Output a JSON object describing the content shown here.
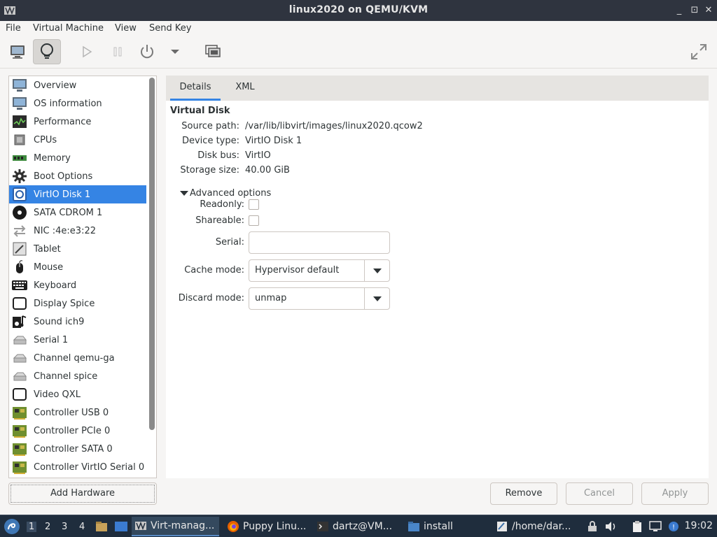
{
  "window": {
    "title": "linux2020 on QEMU/KVM",
    "controls": {
      "minimize": "_",
      "maximize": "⊡",
      "close": "✕"
    }
  },
  "menubar": {
    "items": [
      "File",
      "Virtual Machine",
      "View",
      "Send Key"
    ]
  },
  "toolbar": {
    "icons": [
      "console-icon",
      "details-lightbulb-icon",
      "run-play-icon",
      "pause-icon",
      "power-icon",
      "dropdown-arrow-icon",
      "snapshots-icon",
      "fullscreen-icon"
    ]
  },
  "sidebar": {
    "selected_index": 6,
    "items": [
      {
        "label": "Overview",
        "icon": "monitor-icon"
      },
      {
        "label": "OS information",
        "icon": "monitor-icon"
      },
      {
        "label": "Performance",
        "icon": "performance-graph-icon"
      },
      {
        "label": "CPUs",
        "icon": "cpu-chip-icon"
      },
      {
        "label": "Memory",
        "icon": "memory-module-icon"
      },
      {
        "label": "Boot Options",
        "icon": "gear-icon"
      },
      {
        "label": "VirtIO Disk 1",
        "icon": "hard-disk-icon"
      },
      {
        "label": "SATA CDROM 1",
        "icon": "cdrom-icon"
      },
      {
        "label": "NIC :4e:e3:22",
        "icon": "network-arrows-icon"
      },
      {
        "label": "Tablet",
        "icon": "tablet-icon"
      },
      {
        "label": "Mouse",
        "icon": "mouse-icon"
      },
      {
        "label": "Keyboard",
        "icon": "keyboard-icon"
      },
      {
        "label": "Display Spice",
        "icon": "display-icon"
      },
      {
        "label": "Sound ich9",
        "icon": "sound-note-icon"
      },
      {
        "label": "Serial 1",
        "icon": "serial-device-icon"
      },
      {
        "label": "Channel qemu-ga",
        "icon": "channel-device-icon"
      },
      {
        "label": "Channel spice",
        "icon": "channel-device-icon"
      },
      {
        "label": "Video QXL",
        "icon": "video-display-icon"
      },
      {
        "label": "Controller USB 0",
        "icon": "controller-card-icon"
      },
      {
        "label": "Controller PCIe 0",
        "icon": "controller-card-icon"
      },
      {
        "label": "Controller SATA 0",
        "icon": "controller-card-icon"
      },
      {
        "label": "Controller VirtIO Serial 0",
        "icon": "controller-card-icon"
      }
    ],
    "add_hardware_label": "Add Hardware"
  },
  "tabs": [
    {
      "label": "Details",
      "active": true
    },
    {
      "label": "XML",
      "active": false
    }
  ],
  "disk": {
    "section_title": "Virtual Disk",
    "source_path_label": "Source path:",
    "source_path": "/var/lib/libvirt/images/linux2020.qcow2",
    "device_type_label": "Device type:",
    "device_type": "VirtIO Disk 1",
    "disk_bus_label": "Disk bus:",
    "disk_bus": "VirtIO",
    "storage_size_label": "Storage size:",
    "storage_size": "40.00 GiB"
  },
  "advanced": {
    "expander_label": "Advanced options",
    "readonly_label": "Readonly:",
    "readonly_checked": false,
    "shareable_label": "Shareable:",
    "shareable_checked": false,
    "serial_label": "Serial:",
    "serial_value": "",
    "cache_mode_label": "Cache mode:",
    "cache_mode_value": "Hypervisor default",
    "discard_mode_label": "Discard mode:",
    "discard_mode_value": "unmap"
  },
  "actions": {
    "remove": "Remove",
    "cancel": "Cancel",
    "apply": "Apply"
  },
  "taskbar": {
    "workspaces": [
      "1",
      "2",
      "3",
      "4"
    ],
    "active_workspace": "1",
    "tasks": [
      {
        "label": "Virt-manag...",
        "icon": "virt-manager-icon",
        "active": true
      },
      {
        "label": "Puppy Linu...",
        "icon": "firefox-icon",
        "active": false
      },
      {
        "label": "dartz@VM...",
        "icon": "terminal-icon",
        "active": false
      },
      {
        "label": "install",
        "icon": "folder-icon",
        "active": false
      },
      {
        "label": "/home/dar...",
        "icon": "text-editor-icon",
        "active": false
      }
    ],
    "tray_icons": [
      "lock-icon",
      "volume-icon",
      "clipboard-icon",
      "network-icon",
      "update-icon"
    ],
    "clock": "19:02"
  },
  "colors": {
    "selection": "#3584e4",
    "titlebar": "#2f343f",
    "taskbar": "#1f2d3d"
  }
}
